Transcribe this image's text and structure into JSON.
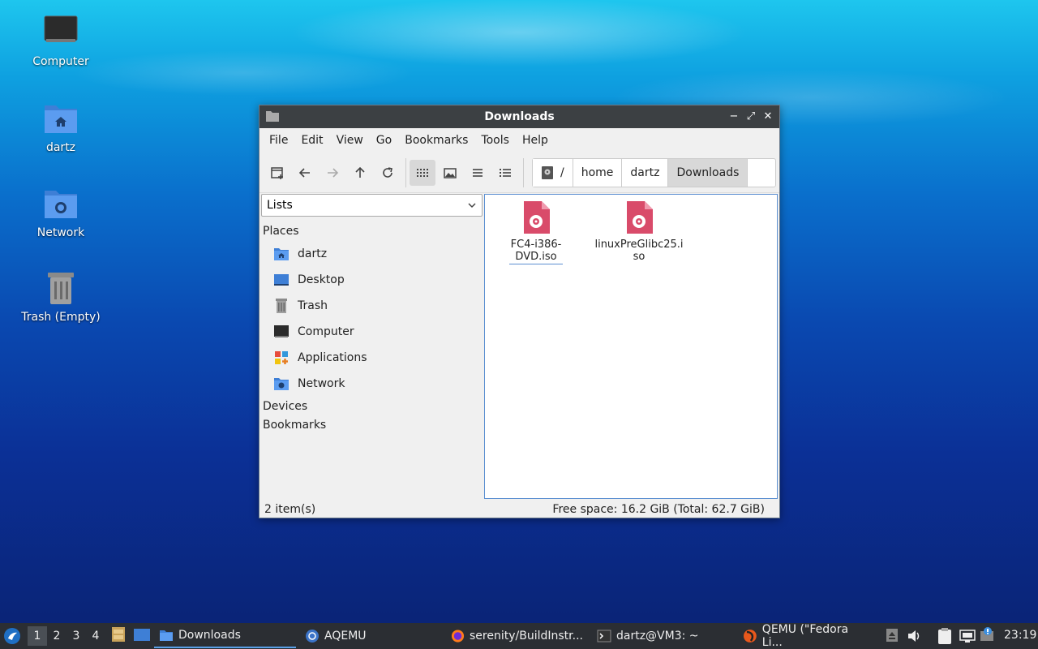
{
  "desktop": {
    "icons": [
      {
        "label": "Computer"
      },
      {
        "label": "dartz"
      },
      {
        "label": "Network"
      },
      {
        "label": "Trash (Empty)"
      }
    ]
  },
  "window": {
    "title": "Downloads",
    "menu": [
      "File",
      "Edit",
      "View",
      "Go",
      "Bookmarks",
      "Tools",
      "Help"
    ],
    "breadcrumbs": [
      "/",
      "home",
      "dartz",
      "Downloads"
    ],
    "sidebar": {
      "combo_value": "Lists",
      "places_heading": "Places",
      "places": [
        "dartz",
        "Desktop",
        "Trash",
        "Computer",
        "Applications",
        "Network"
      ],
      "devices_heading": "Devices",
      "bookmarks_heading": "Bookmarks"
    },
    "files": [
      {
        "name_line1": "FC4-i386-",
        "name_line2": "DVD.iso"
      },
      {
        "name_line1": "linuxPreGlibc25.i",
        "name_line2": "so"
      }
    ],
    "status": {
      "count": "2 item(s)",
      "free_space": "Free space: 16.2 GiB (Total: 62.7 GiB)"
    }
  },
  "taskbar": {
    "workspaces": [
      "1",
      "2",
      "3",
      "4"
    ],
    "tasks": [
      "Downloads",
      "AQEMU",
      "serenity/BuildInstr...",
      "dartz@VM3: ~",
      "QEMU (\"Fedora Li..."
    ],
    "clock": "23:19"
  },
  "colors": {
    "accent": "#5aa0e6",
    "iso_icon": "#d94b6a",
    "folder": "#3e7fd6"
  }
}
